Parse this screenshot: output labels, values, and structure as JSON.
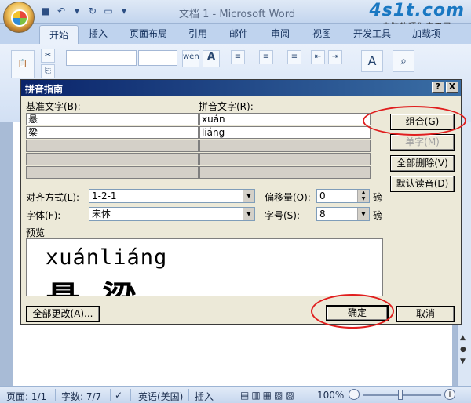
{
  "app": {
    "title": "文档 1 - Microsoft Word",
    "watermark_logo": "4s1t.com",
    "watermark_tagline": "电脑软硬件应用网"
  },
  "ribbon": {
    "tabs": [
      "开始",
      "插入",
      "页面布局",
      "引用",
      "邮件",
      "审阅",
      "视图",
      "开发工具",
      "加载项"
    ],
    "active_tab": "开始"
  },
  "dialog": {
    "title": "拼音指南",
    "help_btn": "?",
    "close_btn": "X",
    "base_label": "基准文字(B):",
    "ruby_label": "拼音文字(R):",
    "rows": [
      {
        "base": "悬",
        "ruby": "xuán"
      },
      {
        "base": "梁",
        "ruby": "liáng"
      }
    ],
    "buttons": {
      "group": "组合(G)",
      "mono": "单字(M)",
      "clear": "全部删除(V)",
      "default_reading": "默认读音(D)",
      "change_all": "全部更改(A)...",
      "ok": "确定",
      "cancel": "取消"
    },
    "alignment_label": "对齐方式(L):",
    "alignment_value": "1-2-1",
    "offset_label": "偏移量(O):",
    "offset_value": "0",
    "offset_unit": "磅",
    "font_label": "字体(F):",
    "font_value": "宋体",
    "size_label": "字号(S):",
    "size_value": "8",
    "size_unit": "磅",
    "preview_label": "预览",
    "preview_pinyin": "xuánliáng",
    "preview_text": "悬梁"
  },
  "statusbar": {
    "page": "页面: 1/1",
    "words": "字数: 7/7",
    "language": "英语(美国)",
    "mode": "插入",
    "zoom": "100%"
  }
}
